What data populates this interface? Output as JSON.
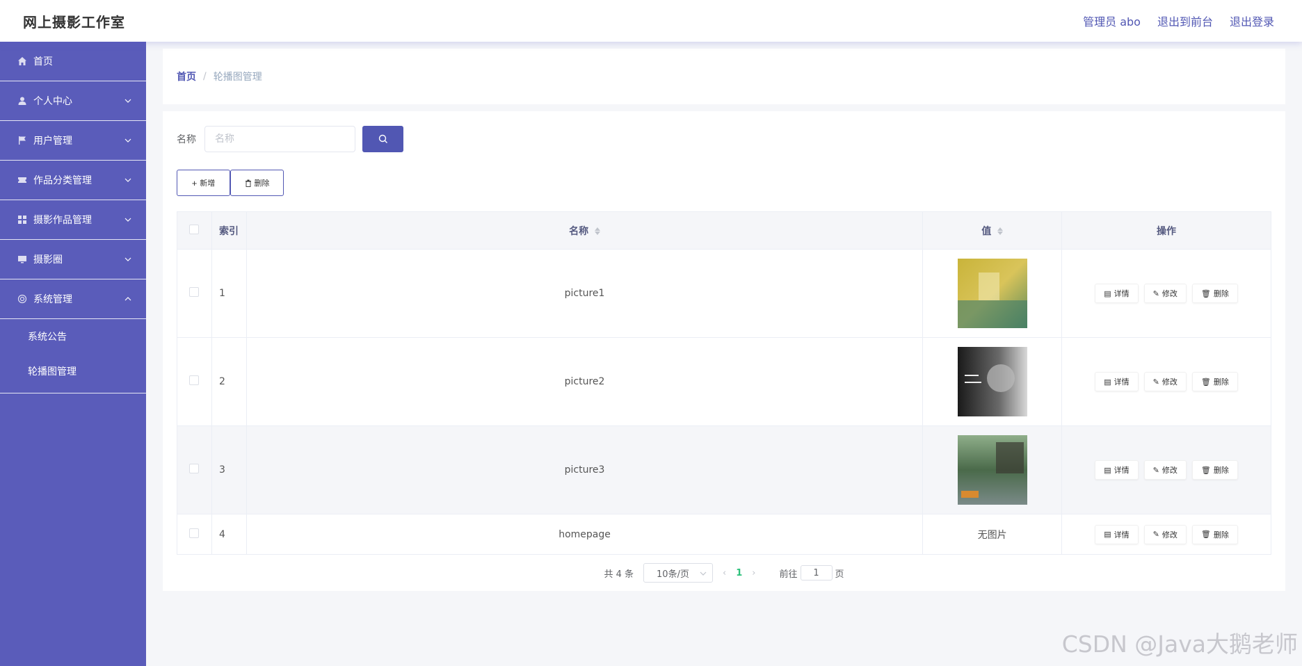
{
  "header": {
    "brand": "网上摄影工作室",
    "links": {
      "admin": "管理员 abo",
      "front": "退出到前台",
      "logout": "退出登录"
    }
  },
  "sidebar": {
    "items": [
      {
        "label": "首页",
        "icon": "home-icon"
      },
      {
        "label": "个人中心",
        "icon": "user-icon"
      },
      {
        "label": "用户管理",
        "icon": "flag-icon"
      },
      {
        "label": "作品分类管理",
        "icon": "ticket-icon"
      },
      {
        "label": "摄影作品管理",
        "icon": "grid-icon"
      },
      {
        "label": "摄影圈",
        "icon": "monitor-icon"
      },
      {
        "label": "系统管理",
        "icon": "globe-icon"
      }
    ],
    "sub_items": [
      "系统公告",
      "轮播图管理"
    ]
  },
  "breadcrumb": {
    "home": "首页",
    "separator": "/",
    "current": "轮播图管理"
  },
  "search": {
    "label": "名称",
    "placeholder": "名称"
  },
  "actions": {
    "add": "新增",
    "delete": "删除"
  },
  "table": {
    "headers": {
      "index": "索引",
      "name": "名称",
      "value": "值",
      "ops": "操作"
    },
    "rows": [
      {
        "index": "1",
        "name": "picture1",
        "value": ""
      },
      {
        "index": "2",
        "name": "picture2",
        "value": ""
      },
      {
        "index": "3",
        "name": "picture3",
        "value": ""
      },
      {
        "index": "4",
        "name": "homepage",
        "value": "无图片"
      }
    ],
    "op_labels": {
      "detail": "详情",
      "edit": "修改",
      "delete": "删除"
    }
  },
  "pagination": {
    "total": "共 4 条",
    "page_size": "10条/页",
    "current_page": "1",
    "goto_prefix": "前往",
    "goto_value": "1",
    "goto_suffix": "页"
  },
  "watermark": "CSDN @Java大鹅老师",
  "colors": {
    "accent": "#5157b3",
    "sidebar": "#5a5cba",
    "active_page": "#2bc07a"
  }
}
